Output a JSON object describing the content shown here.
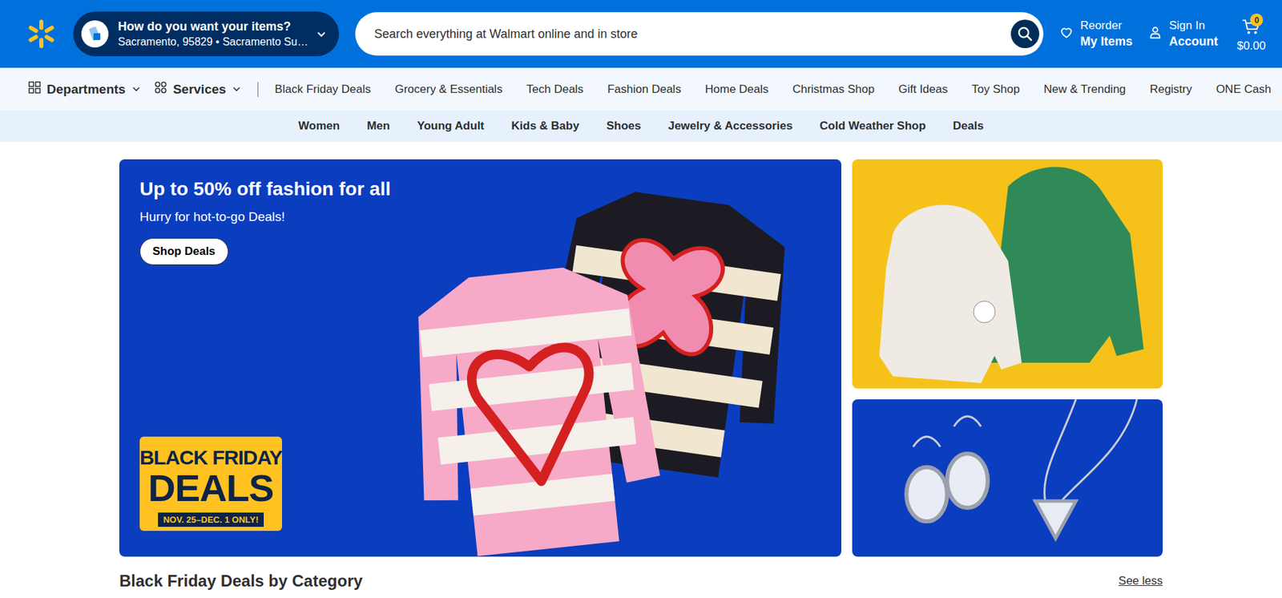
{
  "header": {
    "fulfillment": {
      "title": "How do you want your items?",
      "location": "Sacramento, 95829 • Sacramento Su…"
    },
    "search": {
      "placeholder": "Search everything at Walmart online and in store"
    },
    "reorder": {
      "line1": "Reorder",
      "line2": "My Items"
    },
    "account": {
      "line1": "Sign In",
      "line2": "Account"
    },
    "cart": {
      "count": "0",
      "total": "$0.00"
    }
  },
  "nav": {
    "menus": [
      "Departments",
      "Services"
    ],
    "links": [
      "Black Friday Deals",
      "Grocery & Essentials",
      "Tech Deals",
      "Fashion Deals",
      "Home Deals",
      "Christmas Shop",
      "Gift Ideas",
      "Toy Shop",
      "New & Trending",
      "Registry",
      "ONE Cash"
    ]
  },
  "subnav": [
    "Women",
    "Men",
    "Young Adult",
    "Kids & Baby",
    "Shoes",
    "Jewelry & Accessories",
    "Cold Weather Shop",
    "Deals"
  ],
  "hero": {
    "title": "Up to 50% off fashion for all",
    "subtitle": "Hurry for hot-to-go Deals!",
    "button": "Shop Deals",
    "badge": {
      "line1": "BLACK FRIDAY",
      "line2": "DEALS",
      "dates": "NOV. 25–DEC. 1 ONLY!"
    }
  },
  "section": {
    "title": "Black Friday Deals by Category",
    "link": "See less"
  }
}
